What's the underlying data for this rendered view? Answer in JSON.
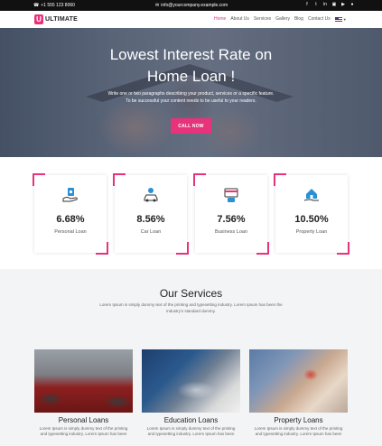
{
  "topbar": {
    "phone": "+1 555 123 8060",
    "email": "info@yourcompany.example.com",
    "socials": [
      "facebook-icon",
      "twitter-icon",
      "linkedin-icon",
      "instagram-icon",
      "youtube-icon",
      "github-icon"
    ]
  },
  "brand": {
    "mark": "U",
    "name": "ULTIMATE"
  },
  "menu": {
    "items": [
      "Home",
      "About Us",
      "Services",
      "Gallery",
      "Blog",
      "Contact Us"
    ],
    "active": "Home"
  },
  "hero": {
    "title_line1": "Lowest Interest Rate on",
    "title_line2": "Home Loan !",
    "text_line1": "Write one or two paragraphs describing your product, services or a specific feature.",
    "text_line2": "To be successful your content needs to be useful to your readers.",
    "cta": "CALL NOW"
  },
  "stats": [
    {
      "value": "6.68%",
      "label": "Personal Loan",
      "icon": "hand-money-icon"
    },
    {
      "value": "8.56%",
      "label": "Car Loan",
      "icon": "car-icon"
    },
    {
      "value": "7.56%",
      "label": "Business Loan",
      "icon": "card-icon"
    },
    {
      "value": "10.50%",
      "label": "Property Loan",
      "icon": "house-hand-icon"
    }
  ],
  "services": {
    "title": "Our Services",
    "sub_line1": "Lorem Ipsum is simply dummy text of the printing and typesetting industry. Lorem Ipsum has been the",
    "sub_line2": "industry's standard dummy.",
    "cards": [
      {
        "title": "Personal Loans",
        "desc1": "Lorem Ipsum is simply dummy text of the printing",
        "desc2": "and typesetting industry. Lorem Ipsum has been"
      },
      {
        "title": "Education Loans",
        "desc1": "Lorem Ipsum is simply dummy text of the printing",
        "desc2": "and typesetting industry. Lorem Ipsum has been"
      },
      {
        "title": "Property Loans",
        "desc1": "Lorem Ipsum is simply dummy text of the printing",
        "desc2": "and typesetting industry. Lorem Ipsum has been"
      }
    ]
  },
  "colors": {
    "accent": "#e6337a",
    "topbar": "#111111",
    "section_bg": "#f3f4f6"
  }
}
